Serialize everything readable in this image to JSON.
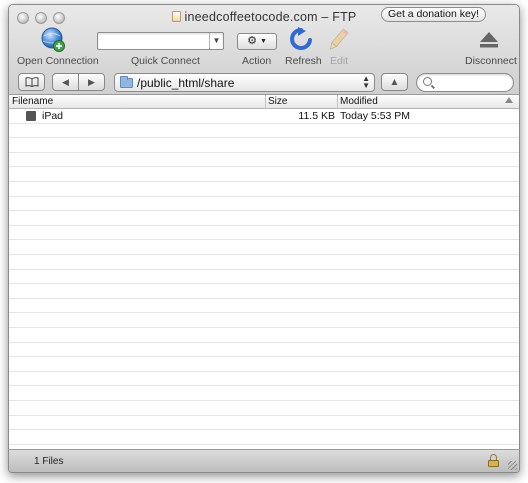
{
  "window": {
    "title": "ineedcoffeetocode.com – FTP",
    "donation_button": "Get a donation key!"
  },
  "toolbar": {
    "open_connection": "Open Connection",
    "quick_connect": "Quick Connect",
    "quick_connect_value": "",
    "action": "Action",
    "refresh": "Refresh",
    "edit": "Edit",
    "disconnect": "Disconnect"
  },
  "navigation": {
    "path": "/public_html/share",
    "search_value": ""
  },
  "columns": [
    "Filename",
    "Size",
    "Modified"
  ],
  "files": [
    {
      "name": "iPad",
      "size": "11.5 KB",
      "modified": "Today 5:53 PM"
    }
  ],
  "status": {
    "file_count": "1 Files"
  },
  "colors": {
    "refresh_blue": "#2f6bd0",
    "connect_green": "#3fa44a"
  },
  "icons": {
    "open_connection": "globe-plus-icon",
    "refresh": "refresh-icon",
    "edit": "pencil-icon",
    "disconnect": "eject-icon",
    "action": "gear-icon",
    "bookmarks": "book-icon",
    "status": "lock-icon"
  }
}
